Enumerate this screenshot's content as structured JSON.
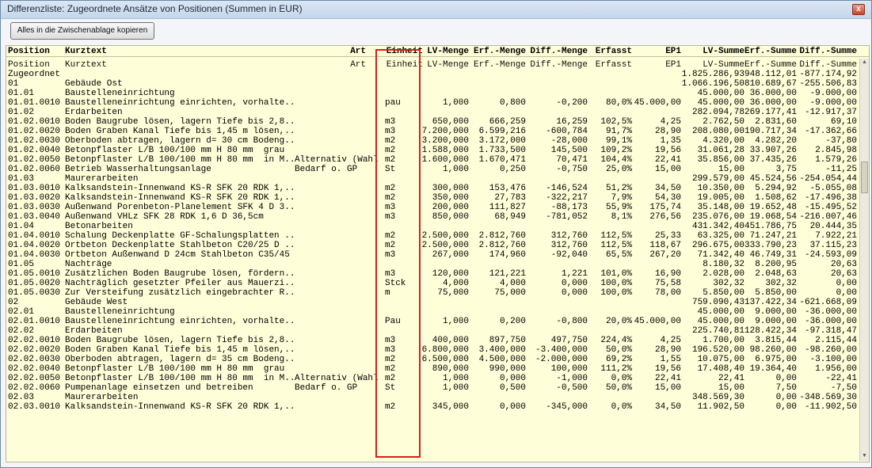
{
  "window": {
    "title": "Differenzliste: Zugeordnete Ansätze von Positionen (Summen in EUR)",
    "close_glyph": "x"
  },
  "toolbar": {
    "copy_label": "Alles in die Zwischenablage kopieren"
  },
  "columns": {
    "position": "Position",
    "kurztext": "Kurztext",
    "art": "Art",
    "einheit": "Einheit",
    "lv_menge": "LV-Menge",
    "erf_menge": "Erf.-Menge",
    "diff_menge": "Diff.-Menge",
    "erfasst": "Erfasst",
    "ep1": "EP1",
    "lv_summe": "LV-Summe",
    "erf_summe": "Erf.-Summe",
    "diff_summe": "Diff.-Summe"
  },
  "rows": [
    {
      "pos": "Zugeordnet",
      "kurz": "",
      "art": "",
      "ein": "",
      "lv": "",
      "erf": "",
      "diff": "",
      "erfa": "",
      "ep1": "",
      "lvs": "1.825.286,93",
      "erfs": "948.112,01",
      "diffs": "-877.174,92"
    },
    {
      "pos": "01",
      "kurz": "Gebäude Ost",
      "art": "",
      "ein": "",
      "lv": "",
      "erf": "",
      "diff": "",
      "erfa": "",
      "ep1": "",
      "lvs": "1.066.196,50",
      "erfs": "810.689,67",
      "diffs": "-255.506,83"
    },
    {
      "pos": "01.01",
      "kurz": "Baustelleneinrichtung",
      "art": "",
      "ein": "",
      "lv": "",
      "erf": "",
      "diff": "",
      "erfa": "",
      "ep1": "",
      "lvs": "45.000,00",
      "erfs": "36.000,00",
      "diffs": "-9.000,00"
    },
    {
      "pos": "01.01.0010",
      "kurz": "Baustelleneinrichtung einrichten, vorhalte...",
      "art": "",
      "ein": "pau",
      "lv": "1,000",
      "erf": "0,800",
      "diff": "-0,200",
      "erfa": "80,0%",
      "ep1": "45.000,00",
      "lvs": "45.000,00",
      "erfs": "36.000,00",
      "diffs": "-9.000,00"
    },
    {
      "pos": "01.02",
      "kurz": "Erdarbeiten",
      "art": "",
      "ein": "",
      "lv": "",
      "erf": "",
      "diff": "",
      "erfa": "",
      "ep1": "",
      "lvs": "282.094,78",
      "erfs": "269.177,41",
      "diffs": "-12.917,37"
    },
    {
      "pos": "01.02.0010",
      "kurz": "Boden Baugrube lösen, lagern Tiefe bis 2,8...",
      "art": "",
      "ein": "m3",
      "lv": "650,000",
      "erf": "666,259",
      "diff": "16,259",
      "erfa": "102,5%",
      "ep1": "4,25",
      "lvs": "2.762,50",
      "erfs": "2.831,60",
      "diffs": "69,10"
    },
    {
      "pos": "01.02.0020",
      "kurz": "Boden Graben Kanal Tiefe bis 1,45 m lösen,...",
      "art": "",
      "ein": "m3",
      "lv": "7.200,000",
      "erf": "6.599,216",
      "diff": "-600,784",
      "erfa": "91,7%",
      "ep1": "28,90",
      "lvs": "208.080,00",
      "erfs": "190.717,34",
      "diffs": "-17.362,66"
    },
    {
      "pos": "01.02.0030",
      "kurz": "Oberboden abtragen, lagern d= 30 cm Bodeng...",
      "art": "",
      "ein": "m2",
      "lv": "3.200,000",
      "erf": "3.172,000",
      "diff": "-28,000",
      "erfa": "99,1%",
      "ep1": "1,35",
      "lvs": "4.320,00",
      "erfs": "4.282,20",
      "diffs": "-37,80"
    },
    {
      "pos": "01.02.0040",
      "kurz": "Betonpflaster L/B 100/100 mm H 80 mm  grau",
      "art": "",
      "ein": "m2",
      "lv": "1.588,000",
      "erf": "1.733,500",
      "diff": "145,500",
      "erfa": "109,2%",
      "ep1": "19,56",
      "lvs": "31.061,28",
      "erfs": "33.907,26",
      "diffs": "2.845,98"
    },
    {
      "pos": "01.02.0050",
      "kurz": "Betonpflaster L/B 100/100 mm H 80 mm  in M...",
      "art": "Alternativ (Wahl",
      "ein": "m2",
      "lv": "1.600,000",
      "erf": "1.670,471",
      "diff": "70,471",
      "erfa": "104,4%",
      "ep1": "22,41",
      "lvs": "35.856,00",
      "erfs": "37.435,26",
      "diffs": "1.579,26"
    },
    {
      "pos": "01.02.0060",
      "kurz": "Betrieb Wasserhaltungsanlage",
      "art": "Bedarf o. GP",
      "ein": "St",
      "lv": "1,000",
      "erf": "0,250",
      "diff": "-0,750",
      "erfa": "25,0%",
      "ep1": "15,00",
      "lvs": "15,00",
      "erfs": "3,75",
      "diffs": "-11,25"
    },
    {
      "pos": "01.03",
      "kurz": "Maurerarbeiten",
      "art": "",
      "ein": "",
      "lv": "",
      "erf": "",
      "diff": "",
      "erfa": "",
      "ep1": "",
      "lvs": "299.579,00",
      "erfs": "45.524,56",
      "diffs": "-254.054,44"
    },
    {
      "pos": "01.03.0010",
      "kurz": "Kalksandstein-Innenwand KS-R SFK 20 RDK 1,...",
      "art": "",
      "ein": "m2",
      "lv": "300,000",
      "erf": "153,476",
      "diff": "-146,524",
      "erfa": "51,2%",
      "ep1": "34,50",
      "lvs": "10.350,00",
      "erfs": "5.294,92",
      "diffs": "-5.055,08"
    },
    {
      "pos": "01.03.0020",
      "kurz": "Kalksandstein-Innenwand KS-R SFK 20 RDK 1,...",
      "art": "",
      "ein": "m2",
      "lv": "350,000",
      "erf": "27,783",
      "diff": "-322,217",
      "erfa": "7,9%",
      "ep1": "54,30",
      "lvs": "19.005,00",
      "erfs": "1.508,62",
      "diffs": "-17.496,38"
    },
    {
      "pos": "01.03.0030",
      "kurz": "Außenwand Porenbeton-Planelement SFK 4 D 3...",
      "art": "",
      "ein": "m3",
      "lv": "200,000",
      "erf": "111,827",
      "diff": "-88,173",
      "erfa": "55,9%",
      "ep1": "175,74",
      "lvs": "35.148,00",
      "erfs": "19.652,48",
      "diffs": "-15.495,52"
    },
    {
      "pos": "01.03.0040",
      "kurz": "Außenwand VHLz SFK 28 RDK 1,6 D 36,5cm",
      "art": "",
      "ein": "m3",
      "lv": "850,000",
      "erf": "68,949",
      "diff": "-781,052",
      "erfa": "8,1%",
      "ep1": "276,56",
      "lvs": "235.076,00",
      "erfs": "19.068,54",
      "diffs": "-216.007,46"
    },
    {
      "pos": "01.04",
      "kurz": "Betonarbeiten",
      "art": "",
      "ein": "",
      "lv": "",
      "erf": "",
      "diff": "",
      "erfa": "",
      "ep1": "",
      "lvs": "431.342,40",
      "erfs": "451.786,75",
      "diffs": "20.444,35"
    },
    {
      "pos": "01.04.0010",
      "kurz": "Schalung Deckenplatte GF-Schalungsplatten ...",
      "art": "",
      "ein": "m2",
      "lv": "2.500,000",
      "erf": "2.812,760",
      "diff": "312,760",
      "erfa": "112,5%",
      "ep1": "25,33",
      "lvs": "63.325,00",
      "erfs": "71.247,21",
      "diffs": "7.922,21"
    },
    {
      "pos": "01.04.0020",
      "kurz": "Ortbeton Deckenplatte Stahlbeton C20/25 D ...",
      "art": "",
      "ein": "m2",
      "lv": "2.500,000",
      "erf": "2.812,760",
      "diff": "312,760",
      "erfa": "112,5%",
      "ep1": "118,67",
      "lvs": "296.675,00",
      "erfs": "333.790,23",
      "diffs": "37.115,23"
    },
    {
      "pos": "01.04.0030",
      "kurz": "Ortbeton Außenwand D 24cm Stahlbeton C35/45",
      "art": "",
      "ein": "m3",
      "lv": "267,000",
      "erf": "174,960",
      "diff": "-92,040",
      "erfa": "65,5%",
      "ep1": "267,20",
      "lvs": "71.342,40",
      "erfs": "46.749,31",
      "diffs": "-24.593,09"
    },
    {
      "pos": "01.05",
      "kurz": "Nachträge",
      "art": "",
      "ein": "",
      "lv": "",
      "erf": "",
      "diff": "",
      "erfa": "",
      "ep1": "",
      "lvs": "8.180,32",
      "erfs": "8.200,95",
      "diffs": "20,63"
    },
    {
      "pos": "01.05.0010",
      "kurz": "Zusätzlichen Boden Baugrube lösen, fördern...",
      "art": "",
      "ein": "m3",
      "lv": "120,000",
      "erf": "121,221",
      "diff": "1,221",
      "erfa": "101,0%",
      "ep1": "16,90",
      "lvs": "2.028,00",
      "erfs": "2.048,63",
      "diffs": "20,63"
    },
    {
      "pos": "01.05.0020",
      "kurz": "Nachträglich gesetzter Pfeiler aus Mauerzi...",
      "art": "",
      "ein": "Stck",
      "lv": "4,000",
      "erf": "4,000",
      "diff": "0,000",
      "erfa": "100,0%",
      "ep1": "75,58",
      "lvs": "302,32",
      "erfs": "302,32",
      "diffs": "0,00"
    },
    {
      "pos": "01.05.0030",
      "kurz": "Zur Versteifung zusätzlich eingebrachter R...",
      "art": "",
      "ein": "m",
      "lv": "75,000",
      "erf": "75,000",
      "diff": "0,000",
      "erfa": "100,0%",
      "ep1": "78,00",
      "lvs": "5.850,00",
      "erfs": "5.850,00",
      "diffs": "0,00"
    },
    {
      "pos": "02",
      "kurz": "Gebäude West",
      "art": "",
      "ein": "",
      "lv": "",
      "erf": "",
      "diff": "",
      "erfa": "",
      "ep1": "",
      "lvs": "759.090,43",
      "erfs": "137.422,34",
      "diffs": "-621.668,09"
    },
    {
      "pos": "02.01",
      "kurz": "Baustelleneinrichtung",
      "art": "",
      "ein": "",
      "lv": "",
      "erf": "",
      "diff": "",
      "erfa": "",
      "ep1": "",
      "lvs": "45.000,00",
      "erfs": "9.000,00",
      "diffs": "-36.000,00"
    },
    {
      "pos": "02.01.0010",
      "kurz": "Baustelleneinrichtung einrichten, vorhalte...",
      "art": "",
      "ein": "Pau",
      "lv": "1,000",
      "erf": "0,200",
      "diff": "-0,800",
      "erfa": "20,0%",
      "ep1": "45.000,00",
      "lvs": "45.000,00",
      "erfs": "9.000,00",
      "diffs": "-36.000,00"
    },
    {
      "pos": "02.02",
      "kurz": "Erdarbeiten",
      "art": "",
      "ein": "",
      "lv": "",
      "erf": "",
      "diff": "",
      "erfa": "",
      "ep1": "",
      "lvs": "225.740,81",
      "erfs": "128.422,34",
      "diffs": "-97.318,47"
    },
    {
      "pos": "02.02.0010",
      "kurz": "Boden Baugrube lösen, lagern Tiefe bis 2,8...",
      "art": "",
      "ein": "m3",
      "lv": "400,000",
      "erf": "897,750",
      "diff": "497,750",
      "erfa": "224,4%",
      "ep1": "4,25",
      "lvs": "1.700,00",
      "erfs": "3.815,44",
      "diffs": "2.115,44"
    },
    {
      "pos": "02.02.0020",
      "kurz": "Boden Graben Kanal Tiefe bis 1,45 m lösen,...",
      "art": "",
      "ein": "m3",
      "lv": "6.800,000",
      "erf": "3.400,000",
      "diff": "-3.400,000",
      "erfa": "50,0%",
      "ep1": "28,90",
      "lvs": "196.520,00",
      "erfs": "98.260,00",
      "diffs": "-98.260,00"
    },
    {
      "pos": "02.02.0030",
      "kurz": "Oberboden abtragen, lagern d= 35 cm Bodeng...",
      "art": "",
      "ein": "m2",
      "lv": "6.500,000",
      "erf": "4.500,000",
      "diff": "-2.000,000",
      "erfa": "69,2%",
      "ep1": "1,55",
      "lvs": "10.075,00",
      "erfs": "6.975,00",
      "diffs": "-3.100,00"
    },
    {
      "pos": "02.02.0040",
      "kurz": "Betonpflaster L/B 100/100 mm H 80 mm  grau",
      "art": "",
      "ein": "m2",
      "lv": "890,000",
      "erf": "990,000",
      "diff": "100,000",
      "erfa": "111,2%",
      "ep1": "19,56",
      "lvs": "17.408,40",
      "erfs": "19.364,40",
      "diffs": "1.956,00"
    },
    {
      "pos": "02.02.0050",
      "kurz": "Betonpflaster L/B 100/100 mm H 80 mm  in M...",
      "art": "Alternativ (Wahl",
      "ein": "m2",
      "lv": "1,000",
      "erf": "0,000",
      "diff": "-1,000",
      "erfa": "0,0%",
      "ep1": "22,41",
      "lvs": "22,41",
      "erfs": "0,00",
      "diffs": "-22,41"
    },
    {
      "pos": "02.02.0060",
      "kurz": "Pumpenanlage einsetzen und betreiben",
      "art": "Bedarf o. GP",
      "ein": "St",
      "lv": "1,000",
      "erf": "0,500",
      "diff": "-0,500",
      "erfa": "50,0%",
      "ep1": "15,00",
      "lvs": "15,00",
      "erfs": "7,50",
      "diffs": "-7,50"
    },
    {
      "pos": "02.03",
      "kurz": "Maurerarbeiten",
      "art": "",
      "ein": "",
      "lv": "",
      "erf": "",
      "diff": "",
      "erfa": "",
      "ep1": "",
      "lvs": "348.569,30",
      "erfs": "0,00",
      "diffs": "-348.569,30"
    },
    {
      "pos": "02.03.0010",
      "kurz": "Kalksandstein-Innenwand KS-R SFK 20 RDK 1,...",
      "art": "",
      "ein": "m2",
      "lv": "345,000",
      "erf": "0,000",
      "diff": "-345,000",
      "erfa": "0,0%",
      "ep1": "34,50",
      "lvs": "11.902,50",
      "erfs": "0,00",
      "diffs": "-11.902,50"
    }
  ],
  "colors": {
    "grid_bg": "#fefed8",
    "highlight": "#e01b1b"
  }
}
